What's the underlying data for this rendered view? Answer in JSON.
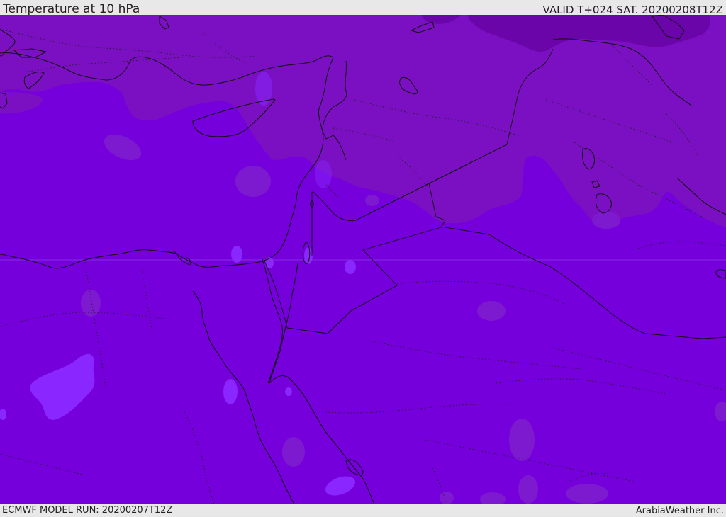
{
  "header": {
    "title": "Temperature at 10 hPa",
    "valid_time": "VALID T+024 SAT. 20200208T12Z"
  },
  "footer": {
    "model_run": "ECMWF MODEL RUN: 20200207T12Z",
    "credit": "ArabiaWeather Inc."
  },
  "map": {
    "field": "temperature",
    "colors": {
      "base": "#7500dc",
      "warm_region": "#7b0fc0",
      "warmer_region": "#6c06ab",
      "cold_patch": "#7d1ad0",
      "cool_patch": "#8a26ff",
      "coastline": "#111111"
    }
  }
}
